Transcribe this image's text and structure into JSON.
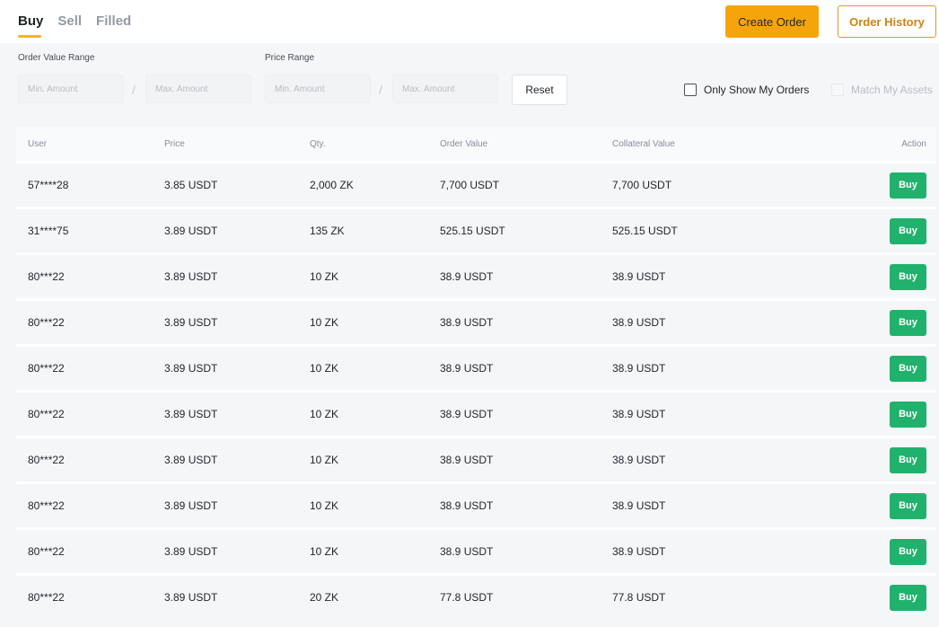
{
  "tabs": [
    {
      "label": "Buy",
      "active": true
    },
    {
      "label": "Sell",
      "active": false
    },
    {
      "label": "Filled",
      "active": false
    }
  ],
  "actions": {
    "create_order": "Create Order",
    "order_history": "Order History"
  },
  "colors": {
    "accent": "#f5a50b",
    "buy": "#20b26c"
  },
  "filters": {
    "order_value_label": "Order Value Range",
    "price_label": "Price Range",
    "min_placeholder": "Min. Amount",
    "max_placeholder": "Max. Amount",
    "separator": "/",
    "reset": "Reset",
    "only_my_orders": "Only Show My Orders",
    "match_assets": "Match My Assets"
  },
  "table": {
    "headers": {
      "user": "User",
      "price": "Price",
      "qty": "Qty.",
      "order_value": "Order Value",
      "collateral_value": "Collateral Value",
      "action": "Action"
    },
    "rows": [
      {
        "user": "57****28",
        "price": "3.85 USDT",
        "qty": "2,000 ZK",
        "order_value": "7,700 USDT",
        "collateral_value": "7,700 USDT",
        "action": "Buy"
      },
      {
        "user": "31****75",
        "price": "3.89 USDT",
        "qty": "135 ZK",
        "order_value": "525.15 USDT",
        "collateral_value": "525.15 USDT",
        "action": "Buy"
      },
      {
        "user": "80***22",
        "price": "3.89 USDT",
        "qty": "10 ZK",
        "order_value": "38.9 USDT",
        "collateral_value": "38.9 USDT",
        "action": "Buy"
      },
      {
        "user": "80***22",
        "price": "3.89 USDT",
        "qty": "10 ZK",
        "order_value": "38.9 USDT",
        "collateral_value": "38.9 USDT",
        "action": "Buy"
      },
      {
        "user": "80***22",
        "price": "3.89 USDT",
        "qty": "10 ZK",
        "order_value": "38.9 USDT",
        "collateral_value": "38.9 USDT",
        "action": "Buy"
      },
      {
        "user": "80***22",
        "price": "3.89 USDT",
        "qty": "10 ZK",
        "order_value": "38.9 USDT",
        "collateral_value": "38.9 USDT",
        "action": "Buy"
      },
      {
        "user": "80***22",
        "price": "3.89 USDT",
        "qty": "10 ZK",
        "order_value": "38.9 USDT",
        "collateral_value": "38.9 USDT",
        "action": "Buy"
      },
      {
        "user": "80***22",
        "price": "3.89 USDT",
        "qty": "10 ZK",
        "order_value": "38.9 USDT",
        "collateral_value": "38.9 USDT",
        "action": "Buy"
      },
      {
        "user": "80***22",
        "price": "3.89 USDT",
        "qty": "10 ZK",
        "order_value": "38.9 USDT",
        "collateral_value": "38.9 USDT",
        "action": "Buy"
      },
      {
        "user": "80***22",
        "price": "3.89 USDT",
        "qty": "20 ZK",
        "order_value": "77.8 USDT",
        "collateral_value": "77.8 USDT",
        "action": "Buy"
      }
    ]
  }
}
